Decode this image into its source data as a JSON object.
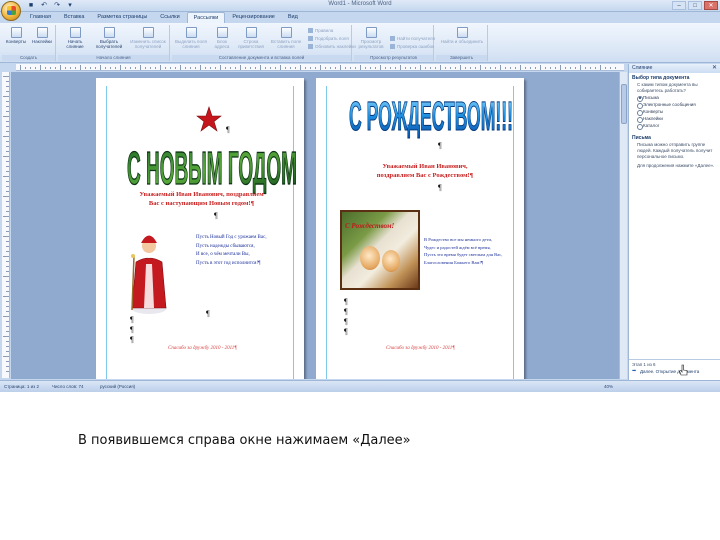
{
  "window": {
    "title": "Word1 - Microsoft Word",
    "controls": [
      "–",
      "□",
      "✕"
    ]
  },
  "quick_access": [
    "■",
    "↶",
    "↷",
    "▾"
  ],
  "tabs": [
    {
      "label": "Главная",
      "active": false
    },
    {
      "label": "Вставка",
      "active": false
    },
    {
      "label": "Разметка страницы",
      "active": false
    },
    {
      "label": "Ссылки",
      "active": false
    },
    {
      "label": "Рассылки",
      "active": true
    },
    {
      "label": "Рецензирование",
      "active": false
    },
    {
      "label": "Вид",
      "active": false
    }
  ],
  "ribbon": {
    "groups": [
      {
        "label": "Создать",
        "buttons": [
          "Конверты",
          "Наклейки"
        ]
      },
      {
        "label": "Начало слияния",
        "buttons": [
          "Начать слияние",
          "Выбрать получателей",
          "Изменить список получателей"
        ]
      },
      {
        "label": "Составление документа и вставка полей",
        "buttons": [
          "Выделить поля слияния",
          "Блок адреса",
          "Строка приветствия",
          "Вставить поле слияния"
        ]
      },
      {
        "label": "Просмотр результатов",
        "buttons": [
          "Просмотр результатов"
        ]
      },
      {
        "label": "Завершить",
        "buttons": [
          "Найти и объединить"
        ]
      }
    ],
    "small_buttons": [
      "Правила",
      "Подобрать поля",
      "Обновить наклейки",
      "Найти получателя",
      "Проверка ошибок"
    ]
  },
  "document": {
    "page1": {
      "wordart": "С НОВЫМ ГОДОМ",
      "greeting": [
        "Уважаемый Иван Иванович, поздравляем",
        "Вас с наступающим Новым годом!¶"
      ],
      "verse": [
        "Пусть Новый Год с урожаем Вас,",
        "Пусть надежды сбываются,",
        "И все, о чём мечтали Вы,",
        "Пусть в этот год исполнится!¶"
      ],
      "footer": "Спасибо за дружбу 2010 - 2011¶"
    },
    "page2": {
      "wordart": "С РОЖДЕСТВОМ!!!",
      "greeting": [
        "Уважаемый Иван Иванович,",
        "поздравляем Вас с Рождеством!¶"
      ],
      "photo_text": "С Рождеством!",
      "verse": [
        "В Рождество все мы немного дети,",
        "Чудес и радостей ждём всё время,",
        "Пусть это время будет светлым для Вас,",
        "Благословения Божьего Вам!¶"
      ],
      "footer": "Спасибо за дружбу 2010 - 2011¶"
    },
    "pilcrow": "¶"
  },
  "task_pane": {
    "title": "Слияние",
    "close": "✕",
    "section1_title": "Выбор типа документа",
    "section1_text": "С каким типом документа вы собираетесь работать?",
    "options": [
      {
        "label": "Письма",
        "selected": true
      },
      {
        "label": "Электронные сообщения",
        "selected": false
      },
      {
        "label": "Конверты",
        "selected": false
      },
      {
        "label": "Наклейки",
        "selected": false
      },
      {
        "label": "Каталог",
        "selected": false
      }
    ],
    "section2_title": "Письма",
    "section2_text": "Письма можно отправить группе людей. Каждый получатель получит персональное письмо.",
    "section2_hint": "Для продолжения нажмите «Далее».",
    "step": "Этап 1 из 6",
    "next_link": "Далее. Открытие документа"
  },
  "status_bar": {
    "page": "Страница: 1 из 2",
    "words": "Число слов: 74",
    "lang": "русский (Россия)",
    "zoom": "40%"
  },
  "caption": "В появившемся справа окне нажимаем «Далее»"
}
